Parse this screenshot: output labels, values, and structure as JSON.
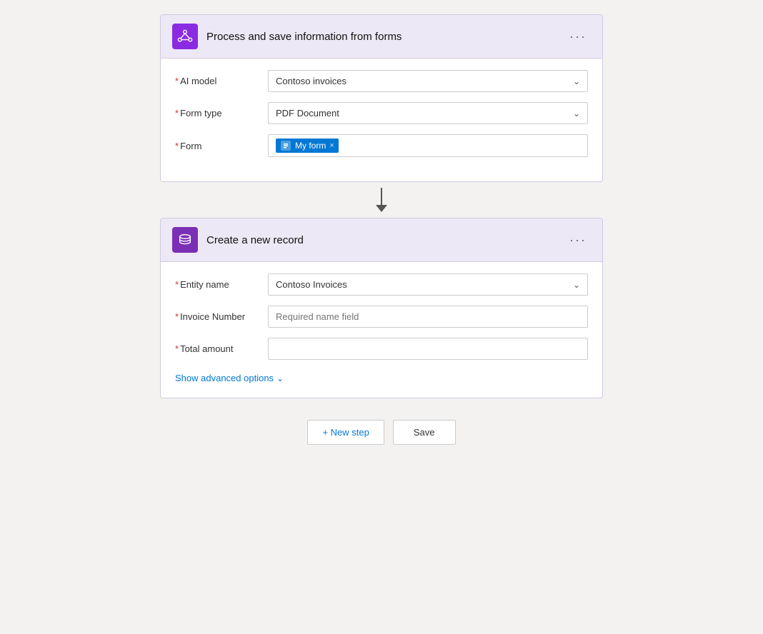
{
  "step1": {
    "title": "Process and save information from forms",
    "icon_name": "ai-builder-icon",
    "menu_label": "···",
    "fields": {
      "ai_model": {
        "label": "AI model",
        "required": true,
        "value": "Contoso invoices"
      },
      "form_type": {
        "label": "Form type",
        "required": true,
        "value": "PDF Document"
      },
      "form": {
        "label": "Form",
        "required": true,
        "tag_label": "My form",
        "tag_close": "×"
      }
    }
  },
  "step2": {
    "title": "Create a new record",
    "icon_name": "dataverse-icon",
    "menu_label": "···",
    "fields": {
      "entity_name": {
        "label": "Entity name",
        "required": true,
        "value": "Contoso Invoices"
      },
      "invoice_number": {
        "label": "Invoice Number",
        "required": true,
        "placeholder": "Required name field"
      },
      "total_amount": {
        "label": "Total amount",
        "required": true,
        "placeholder": ""
      }
    },
    "show_advanced": "Show advanced options"
  },
  "bottom_actions": {
    "new_step_label": "+ New step",
    "save_label": "Save"
  }
}
